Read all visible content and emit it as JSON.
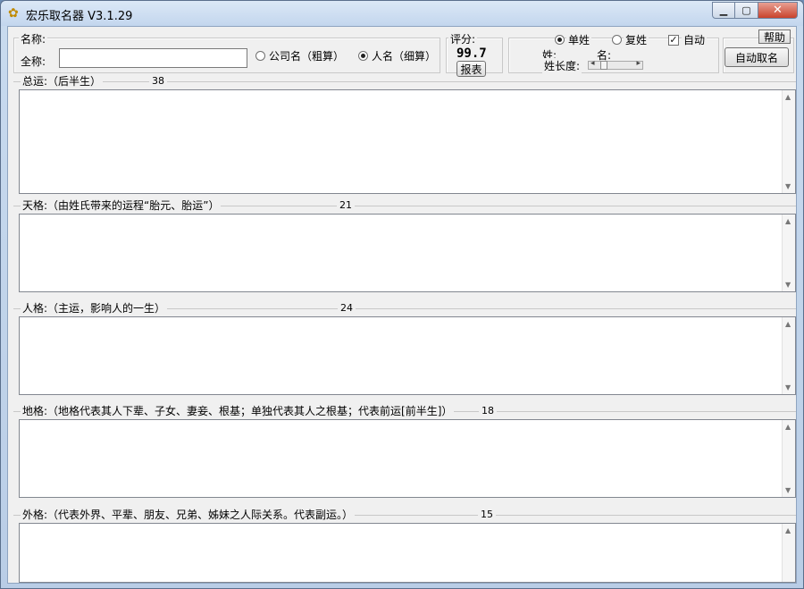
{
  "window": {
    "title": "宏乐取名器 V3.1.29",
    "min_glyph": "▁",
    "max_glyph": "▢",
    "close_glyph": "✕"
  },
  "top": {
    "name_group_label": "名称:",
    "full_name_label": "全称:",
    "full_name_value": "",
    "radio_company": "公司名（粗算）",
    "radio_person": "人名（细算）",
    "selected_mode": "person",
    "score_label": "评分:",
    "score_value": "99.7",
    "report_button": "报表",
    "radio_single_surname": "单姓",
    "radio_double_surname": "复姓",
    "selected_surname": "single",
    "auto_label": "自动",
    "auto_checked": true,
    "surname_label": "姓:",
    "given_label": "名:",
    "surname_length_label": "姓长度:",
    "help_button": "帮助",
    "auto_name_button": "自动取名"
  },
  "sections": [
    {
      "title": "总运:（后半生）",
      "value": "38",
      "text": ""
    },
    {
      "title": "天格:（由姓氏带来的运程“胎元、胎运”）",
      "value": "21",
      "text": ""
    },
    {
      "title": "人格:（主运，影响人的一生）",
      "value": "24",
      "text": ""
    },
    {
      "title": "地格:（地格代表其人下辈、子女、妻妾、根基；单独代表其人之根基；代表前运[前半生]）",
      "value": "18",
      "text": ""
    },
    {
      "title": "外格:（代表外界、平辈、朋友、兄弟、姊妹之人际关系。代表副运。）",
      "value": "15",
      "text": ""
    }
  ]
}
